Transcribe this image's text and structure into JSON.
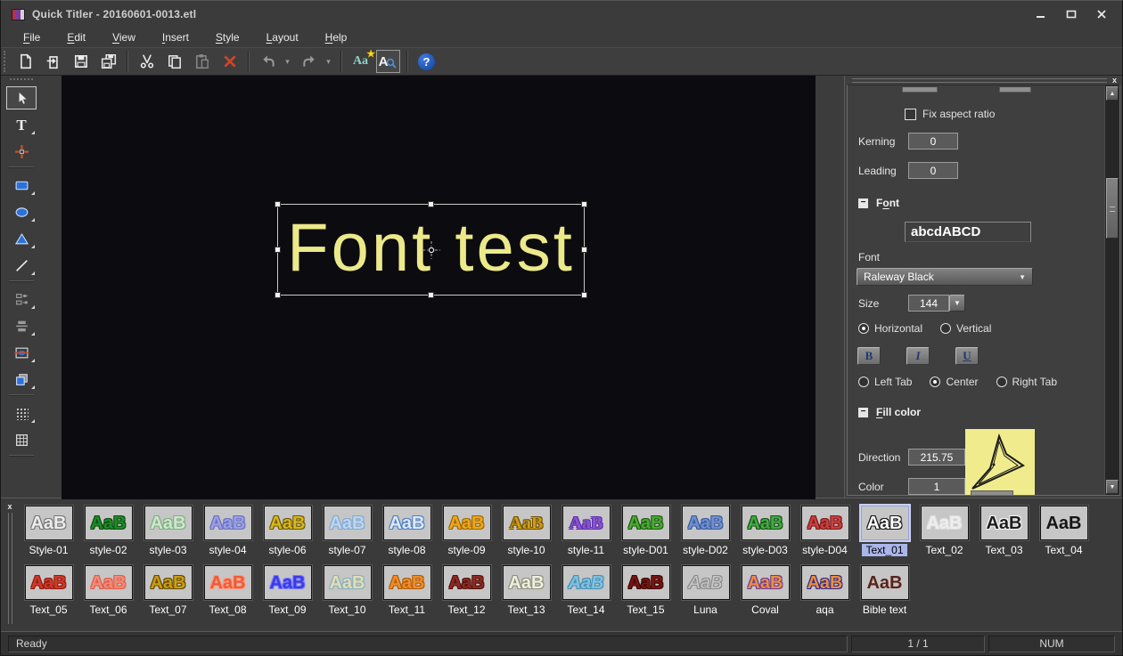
{
  "window": {
    "title": "Quick Titler - 20160601-0013.etl"
  },
  "menu": {
    "items": [
      {
        "label": "File",
        "mnemonic": "F"
      },
      {
        "label": "Edit",
        "mnemonic": "E"
      },
      {
        "label": "View",
        "mnemonic": "V"
      },
      {
        "label": "Insert",
        "mnemonic": "I"
      },
      {
        "label": "Style",
        "mnemonic": "S"
      },
      {
        "label": "Layout",
        "mnemonic": "L"
      },
      {
        "label": "Help",
        "mnemonic": "H"
      }
    ]
  },
  "toolbar": {
    "buttons": [
      {
        "name": "new-document",
        "icon": "new-document-icon"
      },
      {
        "name": "open-file",
        "icon": "open-file-icon"
      },
      {
        "name": "save",
        "icon": "save-icon"
      },
      {
        "name": "save-as",
        "icon": "save-as-icon"
      },
      {
        "separator": true
      },
      {
        "name": "cut",
        "icon": "cut-icon"
      },
      {
        "name": "copy",
        "icon": "copy-icon"
      },
      {
        "name": "paste",
        "icon": "paste-icon",
        "disabled": true
      },
      {
        "name": "delete",
        "icon": "delete-icon"
      },
      {
        "separator": true
      },
      {
        "name": "undo",
        "icon": "undo-icon",
        "disabled": true,
        "dropdown": true
      },
      {
        "name": "redo",
        "icon": "redo-icon",
        "disabled": true,
        "dropdown": true
      },
      {
        "separator": true
      },
      {
        "name": "style-library",
        "icon": "style-library-icon"
      },
      {
        "name": "font-preview",
        "icon": "font-preview-icon",
        "pressed": true
      },
      {
        "separator": true
      },
      {
        "name": "help",
        "icon": "help-icon"
      }
    ]
  },
  "tool_palette": {
    "tools": [
      {
        "name": "select",
        "icon": "cursor-icon",
        "active": true
      },
      {
        "name": "text",
        "icon": "text-icon",
        "flyout": true
      },
      {
        "name": "transform",
        "icon": "transform-icon"
      },
      {
        "separator": true
      },
      {
        "name": "rectangle",
        "icon": "rectangle-icon",
        "flyout": true
      },
      {
        "name": "ellipse",
        "icon": "ellipse-icon",
        "flyout": true
      },
      {
        "name": "triangle",
        "icon": "triangle-icon",
        "flyout": true
      },
      {
        "name": "line",
        "icon": "line-icon",
        "flyout": true
      },
      {
        "separator": true
      },
      {
        "name": "align",
        "icon": "align-objects-icon",
        "flyout": true,
        "disabled": true
      },
      {
        "name": "distribute",
        "icon": "distribute-objects-icon",
        "flyout": true,
        "disabled": true
      },
      {
        "name": "center-in-screen",
        "icon": "center-object-icon",
        "flyout": true
      },
      {
        "name": "layer-order",
        "icon": "layer-order-icon",
        "flyout": true
      },
      {
        "separator": true
      },
      {
        "name": "grid",
        "icon": "grid-icon",
        "flyout": true
      },
      {
        "name": "safe-area",
        "icon": "safe-area-icon"
      },
      {
        "separator": true
      }
    ]
  },
  "canvas": {
    "text": "Font test",
    "text_color": "#ece98b",
    "background": "#0c0c10"
  },
  "properties_panel": {
    "fix_aspect_label": "Fix aspect ratio",
    "kerning_label": "Kerning",
    "kerning_value": "0",
    "leading_label": "Leading",
    "leading_value": "0",
    "font_section": {
      "title": "Font",
      "mnemonic": "o",
      "preview_text": "abcdABCD",
      "font_label": "Font",
      "font_value": "Raleway Black",
      "size_label": "Size",
      "size_value": "144",
      "orientation_options": [
        "Horizontal",
        "Vertical"
      ],
      "orientation_selected": "Horizontal",
      "style_buttons": [
        "B",
        "I",
        "U"
      ],
      "tab_options": [
        "Left Tab",
        "Center",
        "Right Tab"
      ],
      "tab_selected": "Center"
    },
    "fill_section": {
      "title": "Fill color",
      "mnemonic": "F",
      "direction_label": "Direction",
      "direction_value": "215.75",
      "color_label": "Color",
      "color_value": "1",
      "preview_color": "#f0ec8e",
      "swatches": [
        "#f0ec8e",
        "#040404",
        "#040404",
        "#040404",
        "#040404",
        "#040404",
        "#040404"
      ]
    }
  },
  "style_library": {
    "sample_text": "AaB",
    "selected": "Text_01",
    "rows": [
      [
        {
          "label": "Style-01",
          "fg": "#ededed",
          "outline": "#777777"
        },
        {
          "label": "style-02",
          "fg": "#1e8c28",
          "outline": "#0c4a10"
        },
        {
          "label": "style-03",
          "fg": "#cfe6cf",
          "outline": "#7fae7f"
        },
        {
          "label": "style-04",
          "fg": "#9aa0e6",
          "outline": "#6a6ec0"
        },
        {
          "label": "style-06",
          "fg": "#d9b71c",
          "outline": "#6b5a06"
        },
        {
          "label": "style-07",
          "fg": "#bcd6ef",
          "outline": "#86a8cf"
        },
        {
          "label": "style-08",
          "fg": "#dfe9f7",
          "outline": "#4e7fc1"
        },
        {
          "label": "style-09",
          "fg": "#efa61e",
          "outline": "#9a6a00"
        },
        {
          "label": "style-10",
          "fg": "#cf9c16",
          "outline": "#6e4f04",
          "serif": true
        },
        {
          "label": "style-11",
          "fg": "#8a55d0",
          "outline": "#5b2fa8",
          "serif": true
        },
        {
          "label": "style-D01",
          "fg": "#49ab2e",
          "outline": "#1d5a14"
        },
        {
          "label": "style-D02",
          "fg": "#6e8fd2",
          "outline": "#3c5a9a"
        },
        {
          "label": "style-D03",
          "fg": "#41ad41",
          "outline": "#194f19"
        },
        {
          "label": "style-D04",
          "fg": "#c94040",
          "outline": "#7a1a1a"
        },
        {
          "label": "Text_01",
          "fg": "#ffffff",
          "outline": "#141414"
        },
        {
          "label": "Text_02",
          "fg": "#eeeeee",
          "outline": "#dcdcdc"
        },
        {
          "label": "Text_03",
          "fg": "#1c1c1c",
          "outline": "#f5f5f5"
        },
        {
          "label": "Text_04",
          "fg": "#151515"
        }
      ],
      [
        {
          "label": "Text_05",
          "fg": "#cf3a28",
          "outline": "#8f1a10"
        },
        {
          "label": "Text_06",
          "fg": "#ef8d7a",
          "outline": "#e25a46"
        },
        {
          "label": "Text_07",
          "fg": "#cf9c0c",
          "outline": "#5f4a04"
        },
        {
          "label": "Text_08",
          "fg": "#ef5a36",
          "outline": "#ff9a80"
        },
        {
          "label": "Text_09",
          "fg": "#3a3ae6",
          "outline": "#7a7aff"
        },
        {
          "label": "Text_10",
          "fg": "#e5ddb0",
          "outline": "#86b0c0"
        },
        {
          "label": "Text_11",
          "fg": "#ef8d2a",
          "outline": "#b05a08"
        },
        {
          "label": "Text_12",
          "fg": "#8f2a22",
          "outline": "#4f120e"
        },
        {
          "label": "Text_13",
          "fg": "#efefe0",
          "outline": "#8f8f7a"
        },
        {
          "label": "Text_14",
          "fg": "#7ec1e2",
          "outline": "#4a8fb0",
          "italic": true
        },
        {
          "label": "Text_15",
          "fg": "#7a1410",
          "outline": "#3a0806"
        },
        {
          "label": "Luna",
          "fg": "#c8c8c8",
          "outline": "#8a8a8a",
          "italic": true,
          "light": true
        },
        {
          "label": "Coval",
          "fg": "#ef8d3a",
          "outline": "#6a3a9a"
        },
        {
          "label": "aqa",
          "fg": "#ef8d3a",
          "outline": "#2a2a90"
        },
        {
          "label": "Bible text",
          "fg": "#5a241a"
        }
      ]
    ]
  },
  "status_bar": {
    "message": "Ready",
    "page_indicator": "1 / 1",
    "keyboard_state": "NUM"
  }
}
